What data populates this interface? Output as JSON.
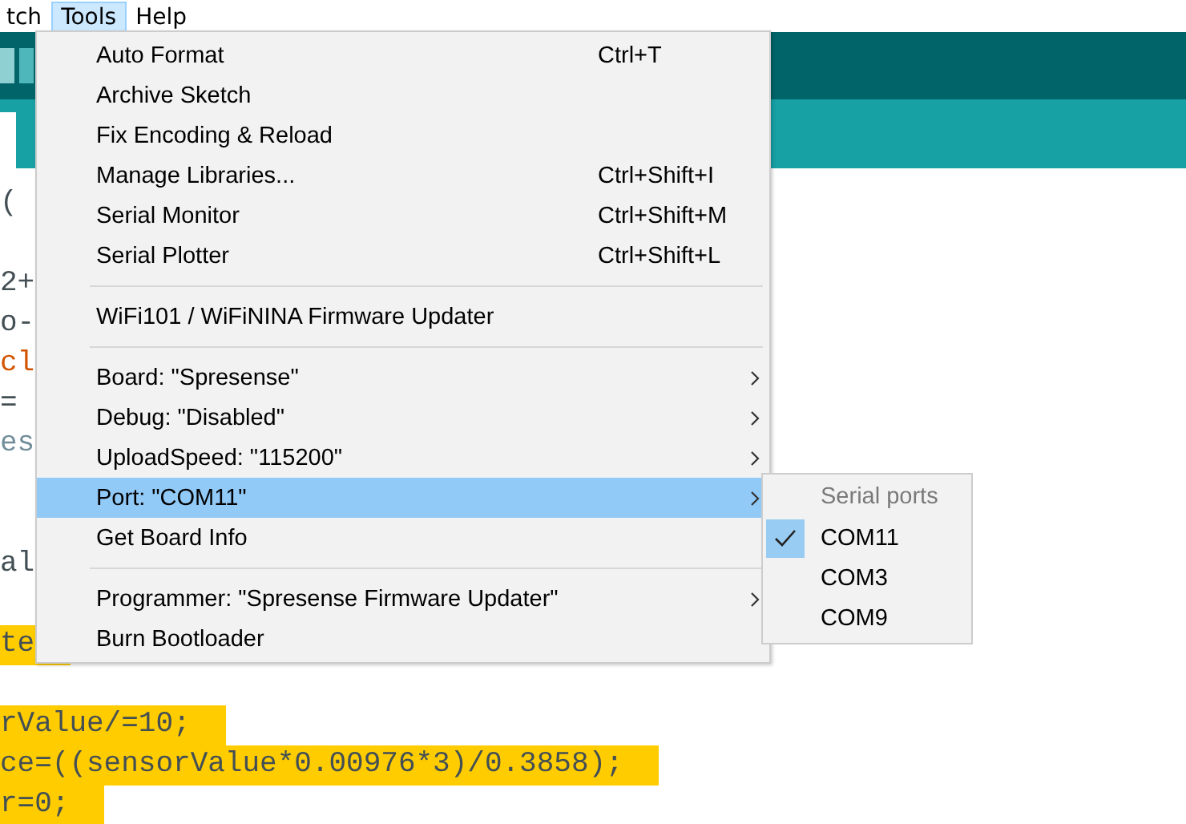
{
  "menu_bar": {
    "items": [
      {
        "label": "tch",
        "selected": false
      },
      {
        "label": "Tools",
        "selected": true
      },
      {
        "label": "Help",
        "selected": false
      }
    ]
  },
  "editor": {
    "lines": [
      {
        "kind": "code",
        "text": "(",
        "color": "#434f54",
        "highlighted": false
      },
      {
        "kind": "blank"
      },
      {
        "kind": "code",
        "text": "2+",
        "color": "#434f54",
        "highlighted": false
      },
      {
        "kind": "code",
        "text": "o-",
        "color": "#434f54",
        "highlighted": false
      },
      {
        "kind": "code",
        "text": "cl",
        "color": "#d35400",
        "highlighted": false
      },
      {
        "kind": "code",
        "text": "=",
        "color": "#434f54",
        "highlighted": false
      },
      {
        "kind": "code",
        "text": "es",
        "color": "#728e9b",
        "highlighted": false
      },
      {
        "kind": "blank"
      },
      {
        "kind": "blank"
      },
      {
        "kind": "code",
        "text": "al",
        "color": "#434f54",
        "highlighted": false
      },
      {
        "kind": "blank"
      },
      {
        "kind": "code",
        "text": "te",
        "color": "#434f54",
        "highlighted": true
      },
      {
        "kind": "blank"
      },
      {
        "kind": "code",
        "text": "rValue/=10;",
        "color": "#434f54",
        "highlighted": true
      },
      {
        "kind": "code",
        "text": "ce=((sensorValue*0.00976*3)/0.3858);",
        "color": "#434f54",
        "highlighted": true
      },
      {
        "kind": "code",
        "text": "r=0;",
        "color": "#434f54",
        "highlighted": true
      }
    ]
  },
  "tools_menu": {
    "groups": [
      [
        {
          "label": "Auto Format",
          "shortcut": "Ctrl+T",
          "has_submenu": false,
          "selected": false
        },
        {
          "label": "Archive Sketch",
          "has_submenu": false,
          "selected": false
        },
        {
          "label": "Fix Encoding & Reload",
          "has_submenu": false,
          "selected": false
        },
        {
          "label": "Manage Libraries...",
          "shortcut": "Ctrl+Shift+I",
          "has_submenu": false,
          "selected": false
        },
        {
          "label": "Serial Monitor",
          "shortcut": "Ctrl+Shift+M",
          "has_submenu": false,
          "selected": false
        },
        {
          "label": "Serial Plotter",
          "shortcut": "Ctrl+Shift+L",
          "has_submenu": false,
          "selected": false
        }
      ],
      [
        {
          "label": "WiFi101 / WiFiNINA Firmware Updater",
          "has_submenu": false,
          "selected": false
        }
      ],
      [
        {
          "label": "Board: \"Spresense\"",
          "has_submenu": true,
          "selected": false
        },
        {
          "label": "Debug: \"Disabled\"",
          "has_submenu": true,
          "selected": false
        },
        {
          "label": "UploadSpeed: \"115200\"",
          "has_submenu": true,
          "selected": false
        },
        {
          "label": "Port: \"COM11\"",
          "has_submenu": true,
          "selected": true
        },
        {
          "label": "Get Board Info",
          "has_submenu": false,
          "selected": false
        }
      ],
      [
        {
          "label": "Programmer: \"Spresense Firmware Updater\"",
          "has_submenu": true,
          "selected": false
        },
        {
          "label": "Burn Bootloader",
          "has_submenu": false,
          "selected": false
        }
      ]
    ]
  },
  "port_submenu": {
    "header": "Serial ports",
    "items": [
      {
        "label": "COM11",
        "checked": true
      },
      {
        "label": "COM3",
        "checked": false
      },
      {
        "label": "COM9",
        "checked": false
      }
    ]
  }
}
